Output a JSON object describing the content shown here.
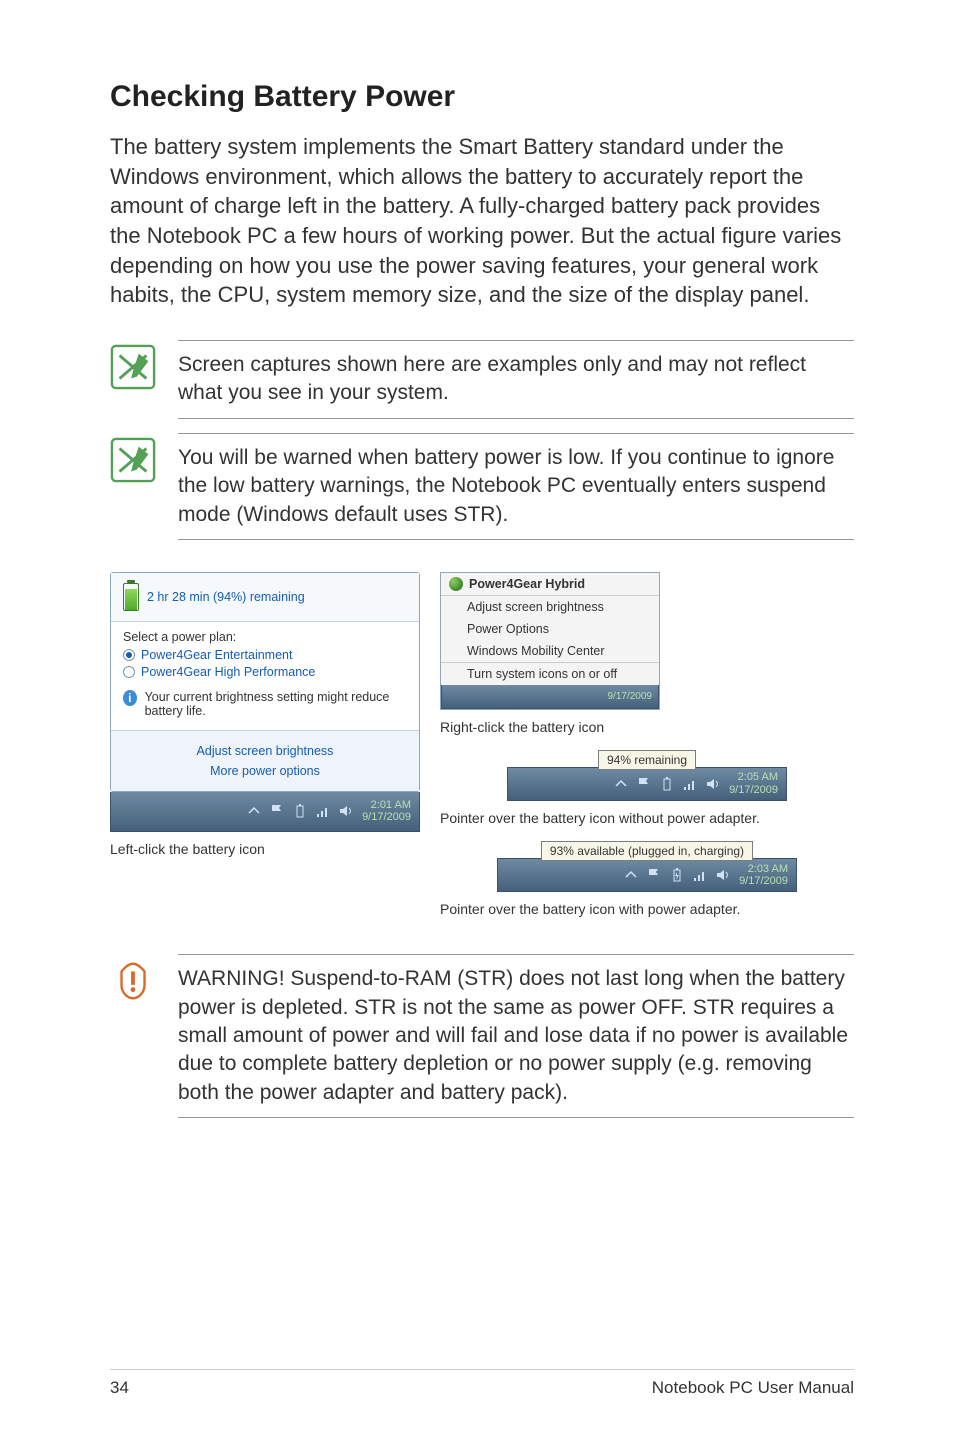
{
  "heading": "Checking Battery Power",
  "paragraph": "The battery system implements the Smart Battery standard under the Windows environment, which allows the battery to accurately report the amount of charge left in the battery. A fully-charged battery pack provides the Notebook PC a few hours of working power. But the actual figure varies depending on how you use the power saving features, your general work habits, the CPU, system memory size, and the size of the display panel.",
  "note1": "Screen captures shown here are examples only and may not reflect what you see in your system.",
  "note2": "You will be warned when battery power is low. If you continue to ignore the low battery warnings, the Notebook PC eventually enters suspend mode (Windows default uses STR).",
  "warning": "WARNING!  Suspend-to-RAM (STR) does not last long when the battery power is depleted. STR is not the same as power OFF. STR requires a small amount of power and will fail and lose data if no power is available due to complete battery depletion or no power supply (e.g. removing both the power adapter and battery pack).",
  "left_popup": {
    "remaining": "2 hr 28 min (94%) remaining",
    "plan_label": "Select a power plan:",
    "plan1": "Power4Gear Entertainment",
    "plan2": "Power4Gear High Performance",
    "info": "Your current brightness setting might reduce battery life.",
    "link1": "Adjust screen brightness",
    "link2": "More power options",
    "clock_time": "2:01 AM",
    "clock_date": "9/17/2009"
  },
  "caption_left": "Left-click the battery icon",
  "ctx": {
    "hdr": "Power4Gear Hybrid",
    "item1": "Adjust screen brightness",
    "item2": "Power Options",
    "item3": "Windows Mobility Center",
    "item4": "Turn system icons on or off",
    "mini_date": "9/17/2009"
  },
  "caption_ctx": "Right-click the battery icon",
  "tip1": {
    "text": "94% remaining",
    "time": "2:05 AM",
    "date": "9/17/2009"
  },
  "caption_tip1": "Pointer over the battery icon without power adapter.",
  "tip2": {
    "text": "93% available (plugged in, charging)",
    "time": "2:03 AM",
    "date": "9/17/2009"
  },
  "caption_tip2": "Pointer over the battery icon with power adapter.",
  "footer": {
    "page": "34",
    "label": "Notebook PC User Manual"
  }
}
